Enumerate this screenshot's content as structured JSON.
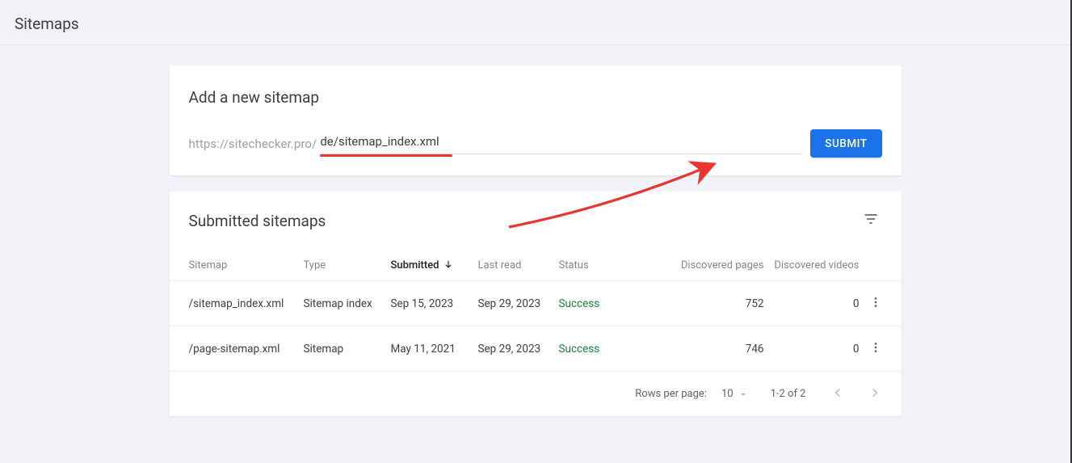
{
  "page_title": "Sitemaps",
  "add_card": {
    "title": "Add a new sitemap",
    "url_prefix": "https://sitechecker.pro/",
    "input_value": "de/sitemap_index.xml",
    "submit_label": "SUBMIT"
  },
  "submitted_card": {
    "title": "Submitted sitemaps",
    "columns": {
      "sitemap": "Sitemap",
      "type": "Type",
      "submitted": "Submitted",
      "last_read": "Last read",
      "status": "Status",
      "discovered_pages": "Discovered pages",
      "discovered_videos": "Discovered videos"
    },
    "rows": [
      {
        "sitemap": "/sitemap_index.xml",
        "type": "Sitemap index",
        "submitted": "Sep 15, 2023",
        "last_read": "Sep 29, 2023",
        "status": "Success",
        "pages": "752",
        "videos": "0"
      },
      {
        "sitemap": "/page-sitemap.xml",
        "type": "Sitemap",
        "submitted": "May 11, 2021",
        "last_read": "Sep 29, 2023",
        "status": "Success",
        "pages": "746",
        "videos": "0"
      }
    ],
    "footer": {
      "rows_per_page_label": "Rows per page:",
      "rows_per_page_value": "10",
      "range_label": "1-2 of 2"
    }
  }
}
